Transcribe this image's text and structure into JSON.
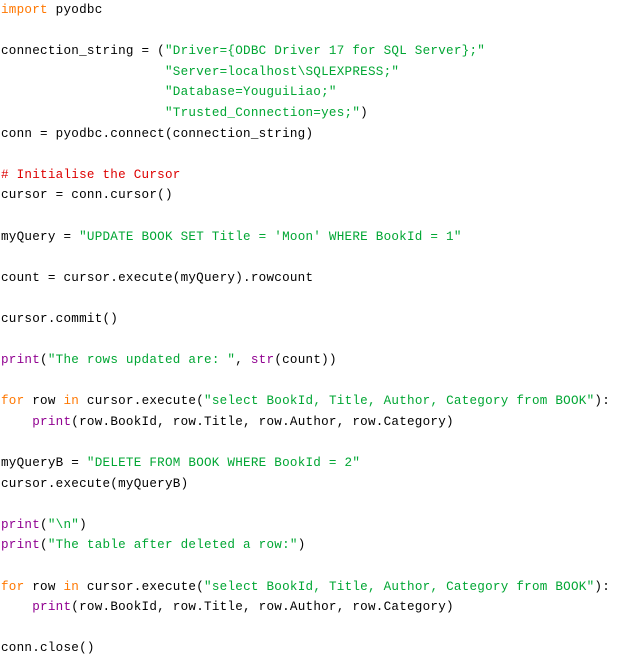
{
  "editor": {
    "language": "python",
    "background": "#ffffff",
    "colors": {
      "plain": "#000000",
      "keyword": "#ff7700",
      "string": "#00a633",
      "comment": "#dd0000",
      "builtin": "#900090"
    }
  },
  "lines": [
    {
      "id": 1,
      "tokens": [
        {
          "t": "import",
          "c": "keyword"
        },
        {
          "t": " pyodbc",
          "c": "plain"
        }
      ]
    },
    {
      "id": 2,
      "tokens": []
    },
    {
      "id": 3,
      "tokens": [
        {
          "t": "connection_string = (",
          "c": "plain"
        },
        {
          "t": "\"Driver={ODBC Driver 17 for SQL Server};\"",
          "c": "string"
        }
      ]
    },
    {
      "id": 4,
      "tokens": [
        {
          "t": "                     ",
          "c": "plain"
        },
        {
          "t": "\"Server=localhost\\SQLEXPRESS;\"",
          "c": "string"
        }
      ]
    },
    {
      "id": 5,
      "tokens": [
        {
          "t": "                     ",
          "c": "plain"
        },
        {
          "t": "\"Database=YouguiLiao;\"",
          "c": "string"
        }
      ]
    },
    {
      "id": 6,
      "tokens": [
        {
          "t": "                     ",
          "c": "plain"
        },
        {
          "t": "\"Trusted_Connection=yes;\"",
          "c": "string"
        },
        {
          "t": ")",
          "c": "plain"
        }
      ]
    },
    {
      "id": 7,
      "tokens": [
        {
          "t": "conn = pyodbc.connect(connection_string)",
          "c": "plain"
        }
      ]
    },
    {
      "id": 8,
      "tokens": []
    },
    {
      "id": 9,
      "tokens": [
        {
          "t": "# Initialise the Cursor",
          "c": "comment"
        }
      ]
    },
    {
      "id": 10,
      "tokens": [
        {
          "t": "cursor = conn.cursor()",
          "c": "plain"
        }
      ]
    },
    {
      "id": 11,
      "tokens": []
    },
    {
      "id": 12,
      "tokens": [
        {
          "t": "myQuery = ",
          "c": "plain"
        },
        {
          "t": "\"UPDATE BOOK SET Title = 'Moon' WHERE BookId = 1\"",
          "c": "string"
        }
      ]
    },
    {
      "id": 13,
      "tokens": []
    },
    {
      "id": 14,
      "tokens": [
        {
          "t": "count = cursor.execute(myQuery).rowcount",
          "c": "plain"
        }
      ]
    },
    {
      "id": 15,
      "tokens": []
    },
    {
      "id": 16,
      "tokens": [
        {
          "t": "cursor.commit()",
          "c": "plain"
        }
      ]
    },
    {
      "id": 17,
      "tokens": []
    },
    {
      "id": 18,
      "tokens": [
        {
          "t": "print",
          "c": "builtin"
        },
        {
          "t": "(",
          "c": "plain"
        },
        {
          "t": "\"The rows updated are: \"",
          "c": "string"
        },
        {
          "t": ", ",
          "c": "plain"
        },
        {
          "t": "str",
          "c": "builtin"
        },
        {
          "t": "(count))",
          "c": "plain"
        }
      ]
    },
    {
      "id": 19,
      "tokens": []
    },
    {
      "id": 20,
      "tokens": [
        {
          "t": "for",
          "c": "keyword"
        },
        {
          "t": " row ",
          "c": "plain"
        },
        {
          "t": "in",
          "c": "keyword"
        },
        {
          "t": " cursor.execute(",
          "c": "plain"
        },
        {
          "t": "\"select BookId, Title, Author, Category from BOOK\"",
          "c": "string"
        },
        {
          "t": "):",
          "c": "plain"
        }
      ]
    },
    {
      "id": 21,
      "tokens": [
        {
          "t": "    ",
          "c": "plain"
        },
        {
          "t": "print",
          "c": "builtin"
        },
        {
          "t": "(row.BookId, row.Title, row.Author, row.Category)",
          "c": "plain"
        }
      ]
    },
    {
      "id": 22,
      "tokens": []
    },
    {
      "id": 23,
      "tokens": [
        {
          "t": "myQueryB = ",
          "c": "plain"
        },
        {
          "t": "\"DELETE FROM BOOK WHERE BookId = 2\"",
          "c": "string"
        }
      ]
    },
    {
      "id": 24,
      "tokens": [
        {
          "t": "cursor.execute(myQueryB)",
          "c": "plain"
        }
      ]
    },
    {
      "id": 25,
      "tokens": []
    },
    {
      "id": 26,
      "tokens": [
        {
          "t": "print",
          "c": "builtin"
        },
        {
          "t": "(",
          "c": "plain"
        },
        {
          "t": "\"\\n\"",
          "c": "string"
        },
        {
          "t": ")",
          "c": "plain"
        }
      ]
    },
    {
      "id": 27,
      "tokens": [
        {
          "t": "print",
          "c": "builtin"
        },
        {
          "t": "(",
          "c": "plain"
        },
        {
          "t": "\"The table after deleted a row:\"",
          "c": "string"
        },
        {
          "t": ")",
          "c": "plain"
        }
      ]
    },
    {
      "id": 28,
      "tokens": []
    },
    {
      "id": 29,
      "tokens": [
        {
          "t": "for",
          "c": "keyword"
        },
        {
          "t": " row ",
          "c": "plain"
        },
        {
          "t": "in",
          "c": "keyword"
        },
        {
          "t": " cursor.execute(",
          "c": "plain"
        },
        {
          "t": "\"select BookId, Title, Author, Category from BOOK\"",
          "c": "string"
        },
        {
          "t": "):",
          "c": "plain"
        }
      ]
    },
    {
      "id": 30,
      "tokens": [
        {
          "t": "    ",
          "c": "plain"
        },
        {
          "t": "print",
          "c": "builtin"
        },
        {
          "t": "(row.BookId, row.Title, row.Author, row.Category)",
          "c": "plain"
        }
      ]
    },
    {
      "id": 31,
      "tokens": []
    },
    {
      "id": 32,
      "tokens": [
        {
          "t": "conn.close()",
          "c": "plain"
        }
      ]
    }
  ]
}
